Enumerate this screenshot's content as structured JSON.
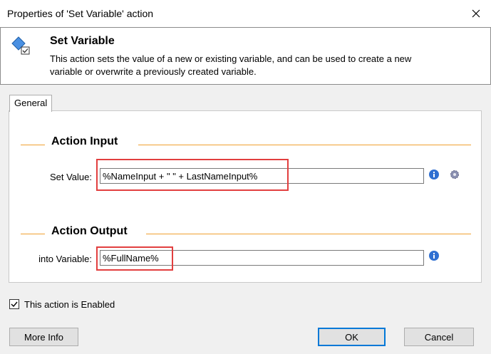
{
  "window": {
    "title": "Properties of 'Set Variable' action"
  },
  "header": {
    "title": "Set Variable",
    "description": "This action sets the value of a new or existing variable, and can be used to create a new variable or overwrite a previously created variable."
  },
  "tabs": [
    {
      "label": "General"
    }
  ],
  "input_section": {
    "title": "Action Input",
    "set_value_label": "Set Value:",
    "set_value": "%NameInput + \" \" + LastNameInput%"
  },
  "output_section": {
    "title": "Action Output",
    "into_variable_label": "into Variable:",
    "into_variable": "%FullName%"
  },
  "enabled": {
    "label": "This action is Enabled",
    "checked": true
  },
  "buttons": {
    "more_info": "More Info",
    "ok": "OK",
    "cancel": "Cancel"
  },
  "colors": {
    "accent_line": "#f0a030",
    "highlight": "#e23f3f",
    "default_button_border": "#0078d7"
  },
  "icons": [
    "close-icon",
    "set-variable-icon",
    "info-icon",
    "gear-icon",
    "checkmark-icon"
  ]
}
